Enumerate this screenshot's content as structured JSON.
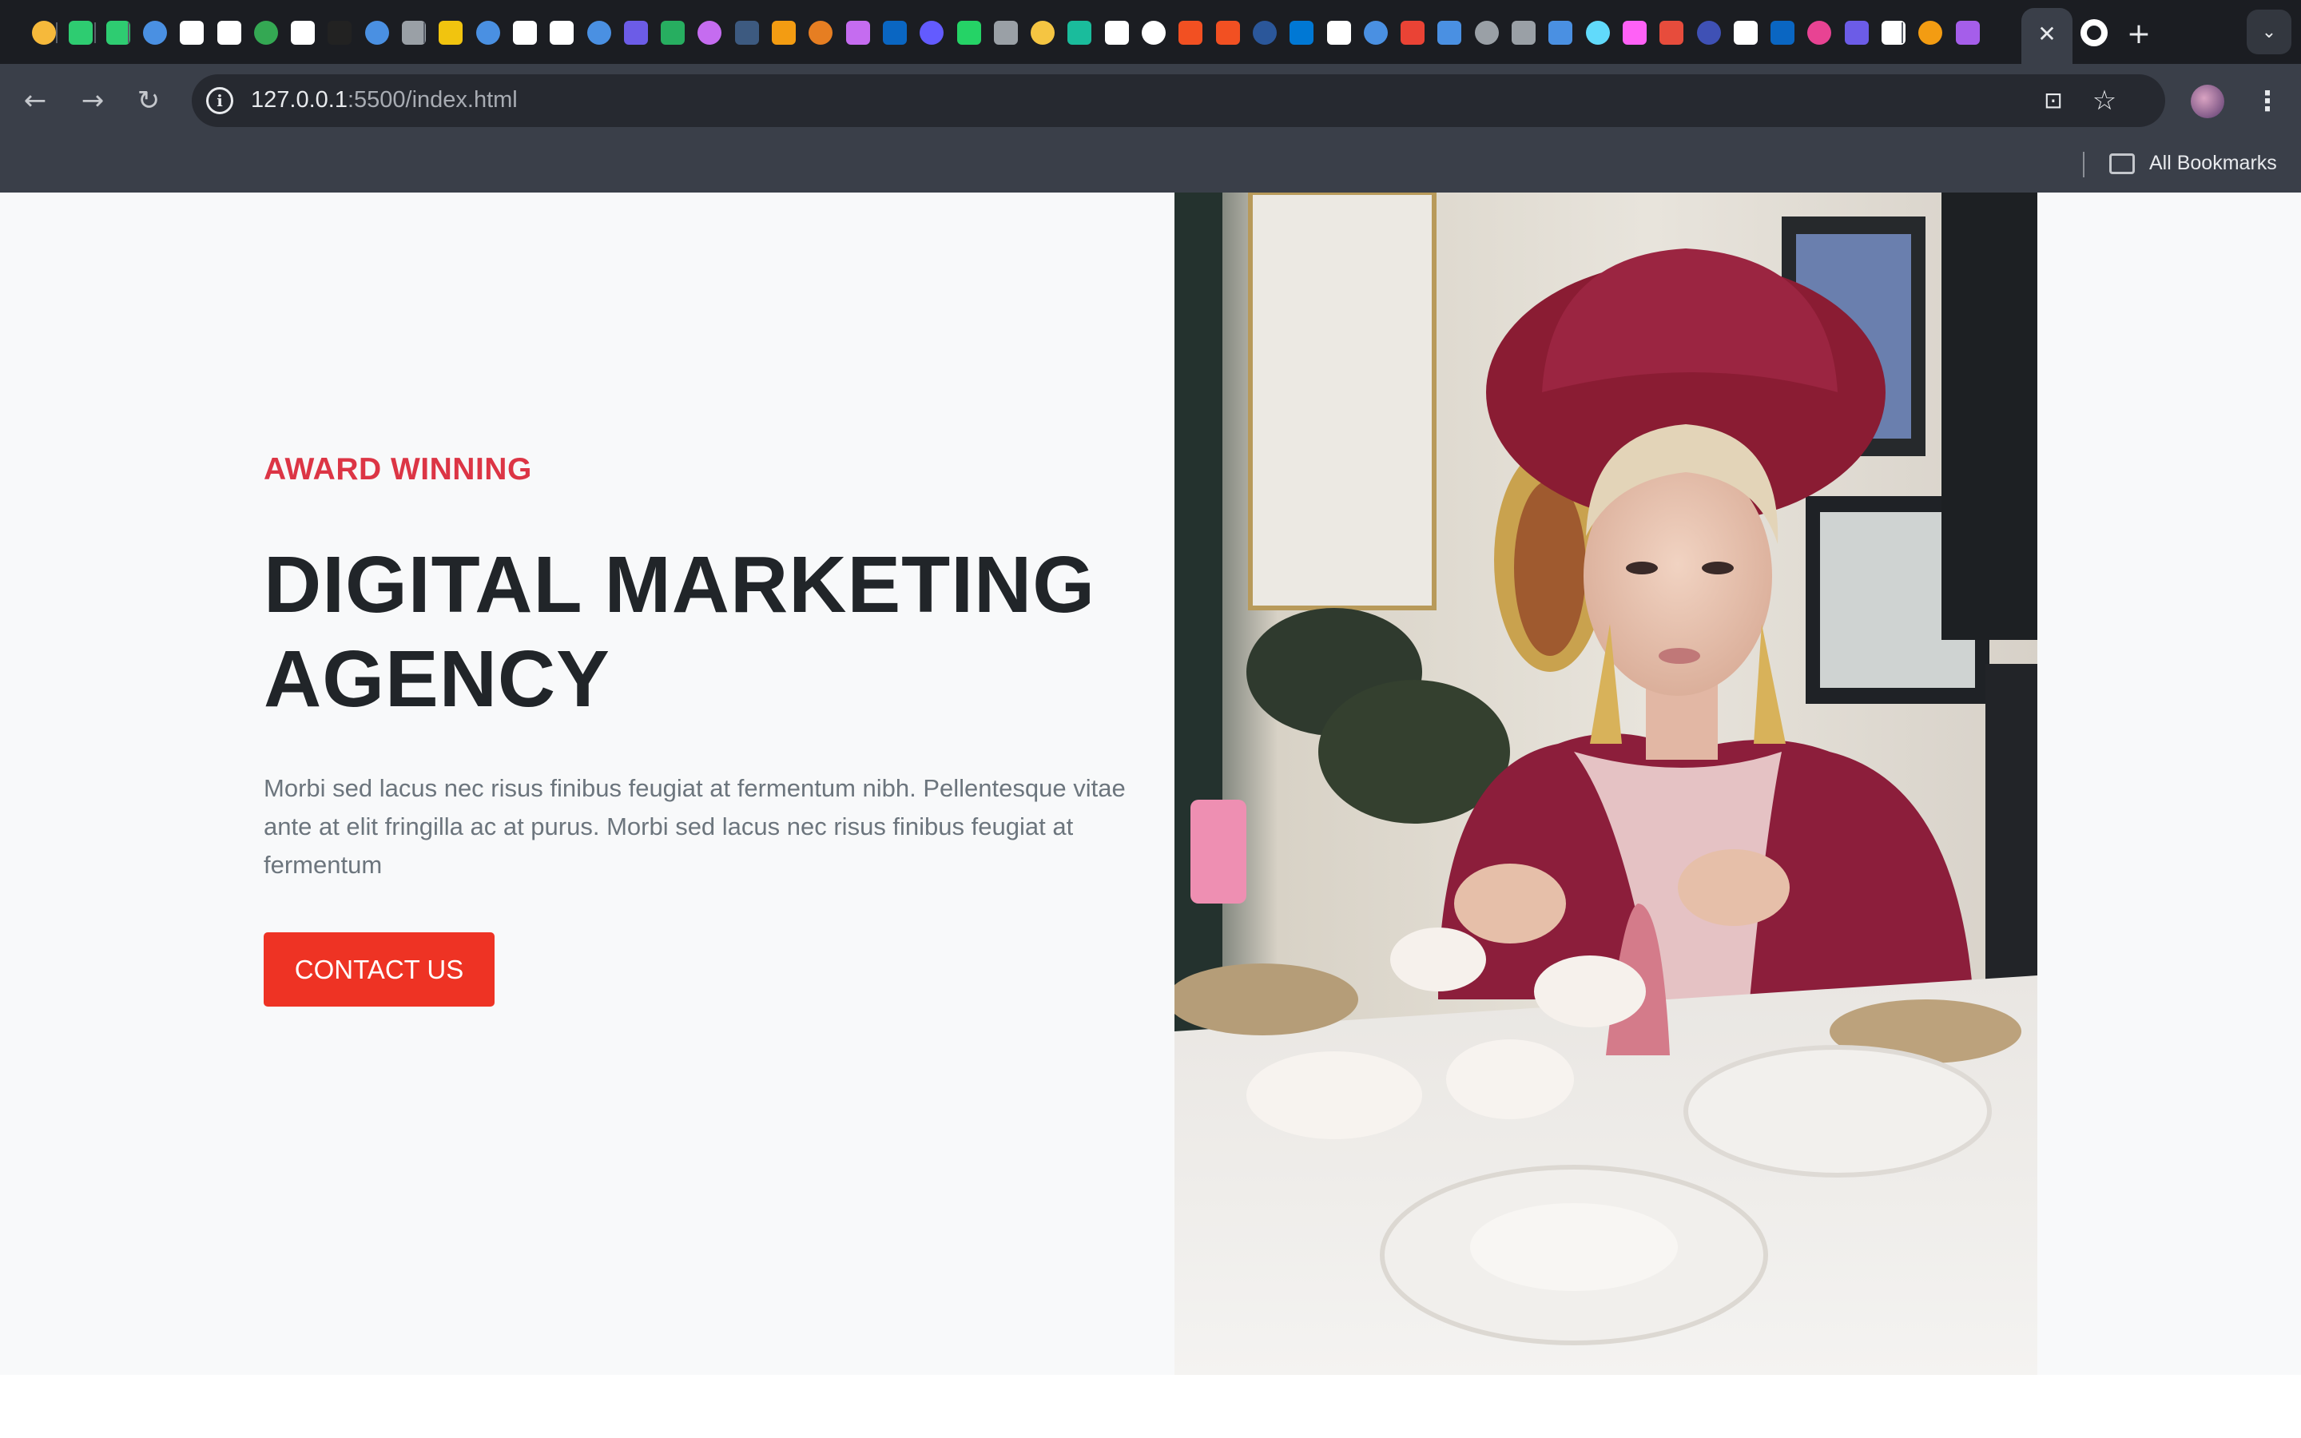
{
  "browser": {
    "url_host": "127.0.0.1",
    "url_path": ":5500/index.html",
    "bookmarks_label": "All Bookmarks",
    "tab_favicons": [
      "openai-icon",
      "tradingview-icon",
      "tradingview-icon",
      "bookmark-icon",
      "wikipedia-icon",
      "google-icon",
      "google-drive-icon",
      "google-icon",
      "medium-icon",
      "flag-icon",
      "code-icon",
      "beer-icon",
      "globe-icon",
      "notion-icon",
      "si-icon",
      "is-icon",
      "list-icon",
      "leaf-icon",
      "arc-icon",
      "dash-icon",
      "headphones-icon",
      "curl-icon",
      "arc-icon",
      "linkedin-icon",
      "stripe-icon",
      "whatsapp-icon",
      "globe-icon",
      "coin-icon",
      "dot-icon",
      "notion-icon",
      "notion-icon",
      "microsoft-icon",
      "microsoft-icon",
      "word-icon",
      "onedrive-icon",
      "github-icon",
      "vercel-icon",
      "gmail-icon",
      "is-icon",
      "globe-icon",
      "globe-icon",
      "is-icon",
      "react-icon",
      "xd-icon",
      "ms-icon",
      "k-icon",
      "calendar-icon",
      "linkedin-icon",
      "shield-icon",
      "s-icon",
      "info-icon",
      "headphones-icon",
      "cloud-icon"
    ]
  },
  "hero": {
    "eyebrow": "AWARD WINNING",
    "headline": "DIGITAL MARKETING AGENCY",
    "lead": "Morbi sed lacus nec risus finibus feugiat at fermentum nibh. Pellentesque vitae ante at elit fringilla ac at purus. Morbi sed lacus nec risus finibus feugiat at fermentum",
    "cta_label": "CONTACT US"
  },
  "colors": {
    "accent": "#dc3545",
    "cta": "#ee3324",
    "heading": "#212529",
    "muted": "#6c757d",
    "page_bg": "#f8f9fa"
  }
}
